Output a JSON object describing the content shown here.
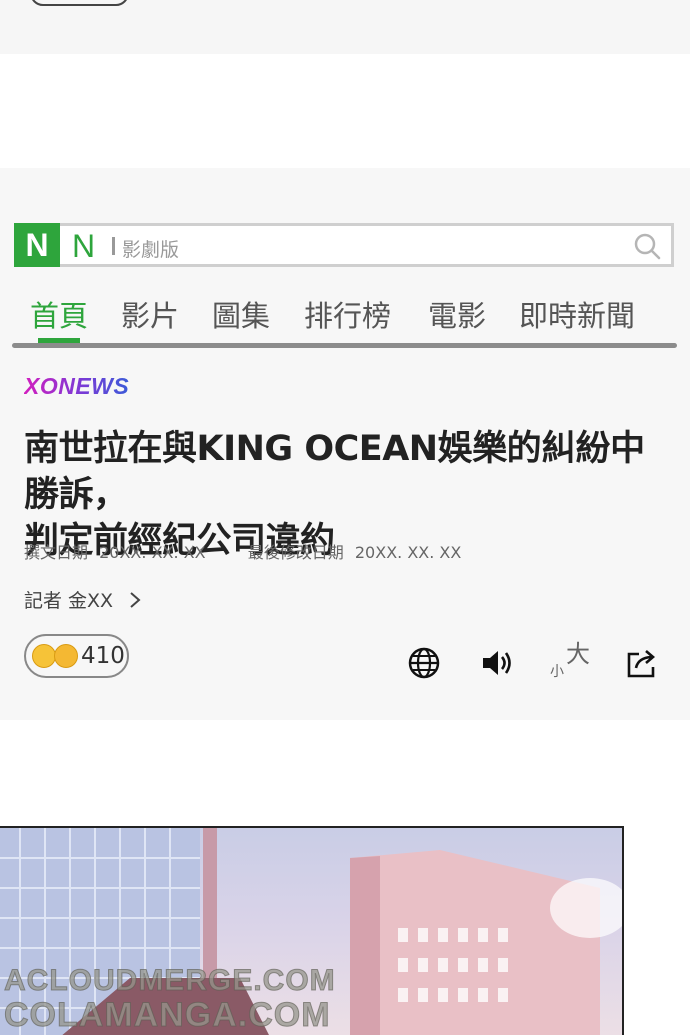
{
  "search": {
    "logo_letter": "N",
    "n_letter": "N",
    "section_label": "影劇版"
  },
  "tabs": [
    {
      "label": "首頁",
      "active": true
    },
    {
      "label": "影片"
    },
    {
      "label": "圖集"
    },
    {
      "label": "排行榜"
    },
    {
      "label": "電影"
    },
    {
      "label": "即時新聞"
    }
  ],
  "article": {
    "brand": "XONEWS",
    "headline_line1": "南世拉在與KING OCEAN娛樂的糾紛中勝訴，",
    "headline_line2": "判定前經紀公司違約",
    "published_label": "撰文日期",
    "published_value": "20XX. XX. XX",
    "modified_label": "最後修改日期",
    "modified_value": "20XX. XX. XX",
    "reporter": "記者 金XX",
    "reaction_count": "410",
    "font_small": "小",
    "font_big": "大"
  },
  "watermark": {
    "line1": "ACLOUDMERGE.COM",
    "line2": "COLAMANGA.COM"
  },
  "icons": [
    "search-icon",
    "chevron-right-icon",
    "globe-icon",
    "speaker-icon",
    "share-icon",
    "emoji-icon"
  ],
  "colors": {
    "accent": "#2ea53c",
    "brand_start": "#d21fbf",
    "brand_end": "#3b5bd8"
  }
}
